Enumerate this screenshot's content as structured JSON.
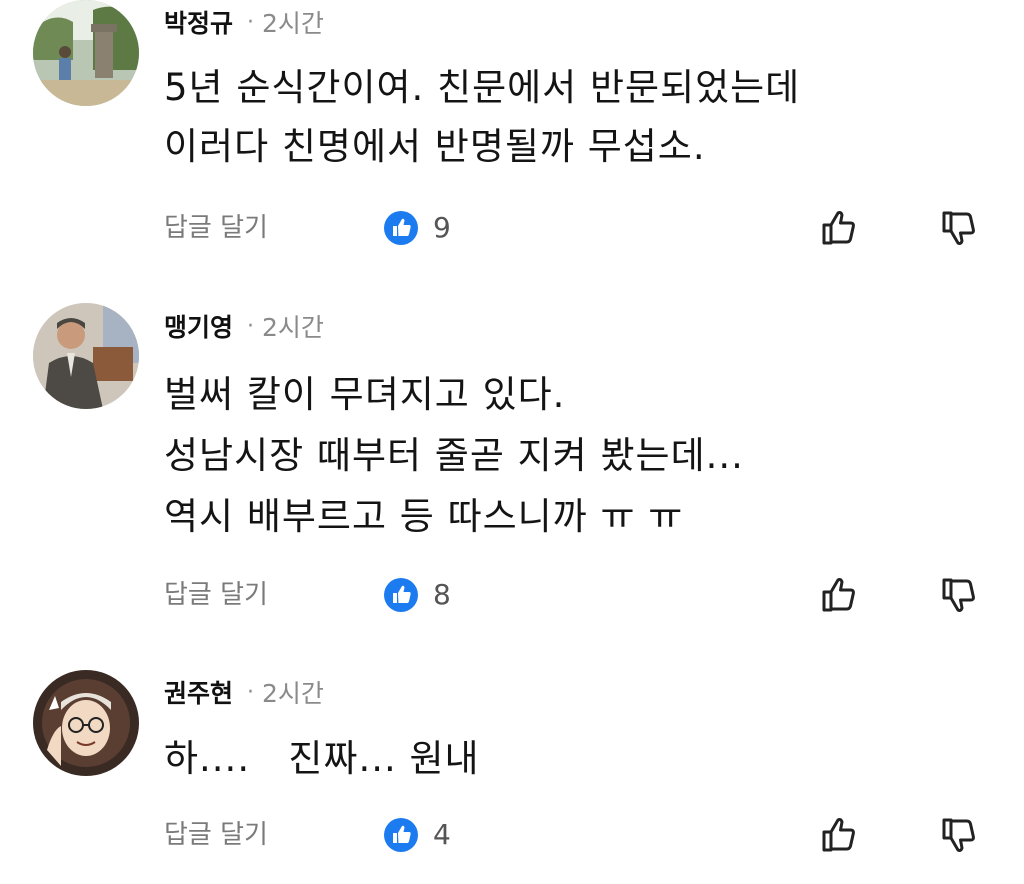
{
  "comments": [
    {
      "author": "박정규",
      "separator": "·",
      "time": "2시간",
      "lines": [
        "5년 순식간이여. 친문에서 반문되었는데",
        "이러다 친명에서 반명될까 무섭소."
      ],
      "reply_label": "답글 달기",
      "like_count": "9",
      "avatar_icon": "avatar-landscape-photo"
    },
    {
      "author": "맹기영",
      "separator": "·",
      "time": "2시간",
      "lines": [
        "벌써 칼이 무뎌지고 있다.",
        "성남시장 때부터 줄곧 지켜 봤는데...",
        "역시 배부르고 등 따스니까 ㅠ ㅠ"
      ],
      "reply_label": "답글 달기",
      "like_count": "8",
      "avatar_icon": "avatar-man-in-suit-photo"
    },
    {
      "author": "권주현",
      "separator": "·",
      "time": "2시간",
      "lines": [
        "하....   진짜... 원내"
      ],
      "reply_label": "답글 달기",
      "like_count": "4",
      "avatar_icon": "avatar-cartoon-portrait"
    }
  ],
  "icons": {
    "like_badge": "thumbs-up-filled-icon",
    "like_action": "thumbs-up-outline-icon",
    "dislike_action": "thumbs-down-outline-icon"
  },
  "colors": {
    "like_badge": "#1d7bf0",
    "secondary_text": "#8a8a8a"
  }
}
